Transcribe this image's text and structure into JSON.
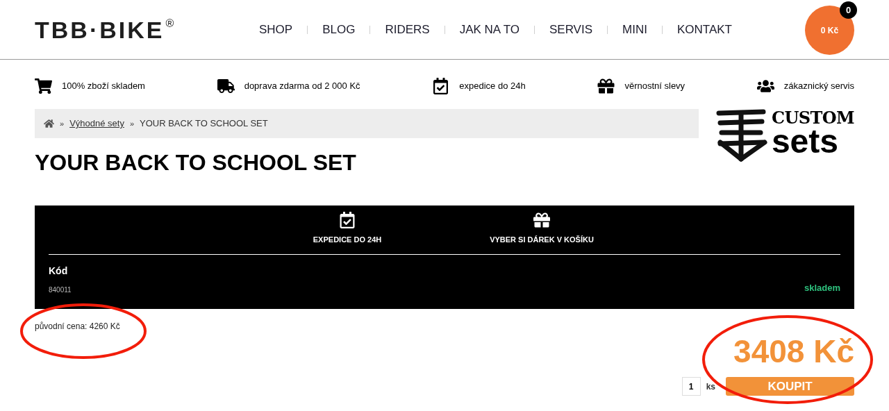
{
  "header": {
    "logo": "TBB·BIKE",
    "logo_mark": "®",
    "nav": [
      "SHOP",
      "BLOG",
      "RIDERS",
      "JAK NA TO",
      "SERVIS",
      "MINI",
      "KONTAKT"
    ],
    "cart": {
      "total": "0 Kč",
      "count": "0"
    }
  },
  "features": [
    {
      "label": "100% zboží skladem"
    },
    {
      "label": "doprava zdarma od 2 000 Kč"
    },
    {
      "label": "expedice do 24h"
    },
    {
      "label": "věrnostní slevy"
    },
    {
      "label": "zákaznický servis"
    }
  ],
  "breadcrumb": {
    "separator": "»",
    "link": "Výhodné sety",
    "current": "YOUR BACK TO SCHOOL SET"
  },
  "brand_logo": {
    "line_1": "CUSTOM",
    "line_2": "sets"
  },
  "title": "YOUR BACK TO SCHOOL SET",
  "product_panel": {
    "benefits": [
      {
        "label": "EXPEDICE DO 24H"
      },
      {
        "label": "VYBER SI DÁREK V KOŠÍKU"
      }
    ],
    "code_label": "Kód",
    "code": "840011",
    "availability": "skladem"
  },
  "original_price": "původní cena: 4260 Kč",
  "price": "3408 Kč",
  "quantity": "1",
  "unit": "ks",
  "buy_button": "KOUPIT"
}
